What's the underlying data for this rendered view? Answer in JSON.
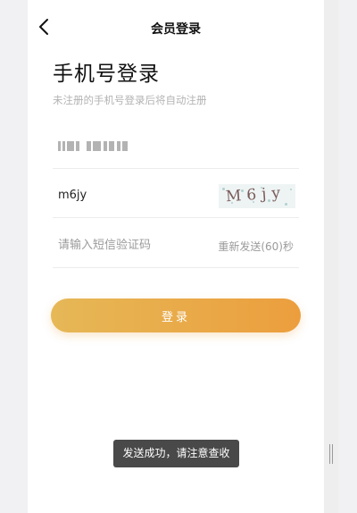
{
  "nav": {
    "title": "会员登录",
    "back_icon": "chevron-left-icon"
  },
  "login": {
    "heading": "手机号登录",
    "subtitle": "未注册的手机号登录后将自动注册"
  },
  "form": {
    "phone_value_obscured": true,
    "captcha": {
      "value": "m6jy",
      "image_text": "M6jy"
    },
    "sms": {
      "placeholder": "请输入短信验证码",
      "resend_label": "重新发送(60)秒"
    },
    "submit_label": "登录"
  },
  "toast": {
    "message": "发送成功，请注意查收"
  },
  "colors": {
    "button_gradient_start": "#e6b857",
    "button_gradient_end": "#ec9e3d",
    "toast_bg": "#303030"
  }
}
